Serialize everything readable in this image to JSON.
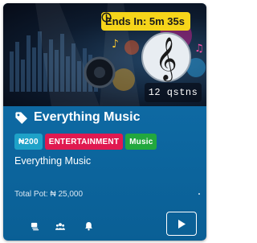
{
  "timer": {
    "label": "Ends In: 5m 35s"
  },
  "banner": {
    "question_count": "12 qstns"
  },
  "quiz": {
    "title": "Everything Music",
    "description": "Everything Music",
    "total_pot": "Total Pot: ₦ 25,000"
  },
  "badges": {
    "price": "₦200",
    "category": "ENTERTAINMENT",
    "subcategory": "Music"
  },
  "footer": {
    "icons": [
      "stack-icon",
      "users-icon",
      "bell-icon"
    ],
    "play_icon": "play-icon"
  },
  "colors": {
    "timer_bg": "#f6d51a",
    "price_badge": "#1ea2c8",
    "category_badge": "#e01950",
    "subcategory_badge": "#22a83e",
    "card_bg": "#0e6aa4"
  }
}
